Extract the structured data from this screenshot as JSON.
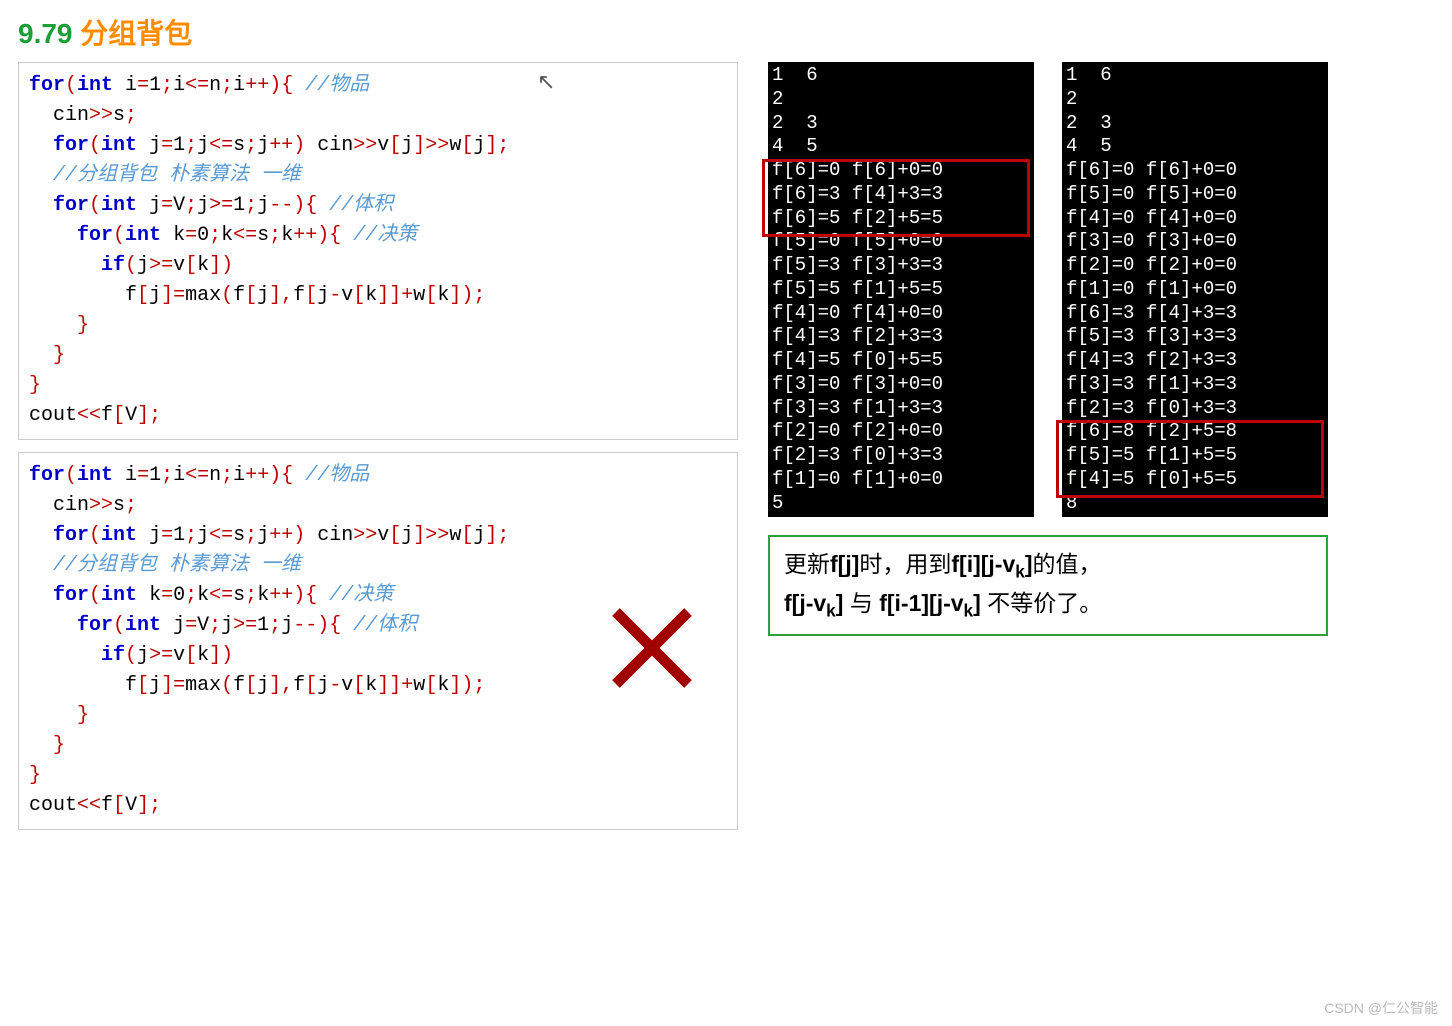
{
  "title": {
    "num": "9.79",
    "txt": "分组背包"
  },
  "code1": {
    "l1a": "for",
    "l1b": "(",
    "l1c": "int",
    "l1d": " i",
    "l1e": "=",
    "l1f": "1",
    "l1g": ";",
    "l1h": "i",
    "l1i": "<=",
    "l1j": "n",
    "l1k": ";",
    "l1l": "i",
    "l1m": "++){",
    "l1n": " //物品",
    "l2a": "  cin",
    "l2b": ">>",
    "l2c": "s",
    "l2d": ";",
    "l3a": "  ",
    "l3b": "for",
    "l3c": "(",
    "l3d": "int",
    "l3e": " j",
    "l3f": "=",
    "l3g": "1",
    "l3h": ";",
    "l3i": "j",
    "l3j": "<=",
    "l3k": "s",
    "l3l": ";",
    "l3m": "j",
    "l3n": "++)",
    "l3o": " cin",
    "l3p": ">>",
    "l3q": "v",
    "l3r": "[",
    "l3s": "j",
    "l3t": "]>>",
    "l3u": "w",
    "l3v": "[",
    "l3w": "j",
    "l3x": "];",
    "l4": "  //分组背包 朴素算法 一维",
    "l5a": "  ",
    "l5b": "for",
    "l5c": "(",
    "l5d": "int",
    "l5e": " j",
    "l5f": "=",
    "l5g": "V",
    "l5h": ";",
    "l5i": "j",
    "l5j": ">=",
    "l5k": "1",
    "l5l": ";",
    "l5m": "j",
    "l5n": "--){",
    "l5o": " //体积",
    "l6a": "    ",
    "l6b": "for",
    "l6c": "(",
    "l6d": "int",
    "l6e": " k",
    "l6f": "=",
    "l6g": "0",
    "l6h": ";",
    "l6i": "k",
    "l6j": "<=",
    "l6k": "s",
    "l6l": ";",
    "l6m": "k",
    "l6n": "++){",
    "l6o": " //决策",
    "l7a": "      ",
    "l7b": "if",
    "l7c": "(",
    "l7d": "j",
    "l7e": ">=",
    "l7f": "v",
    "l7g": "[",
    "l7h": "k",
    "l7i": "])",
    "l8a": "        f",
    "l8b": "[",
    "l8c": "j",
    "l8d": "]=",
    "l8e": "max",
    "l8f": "(",
    "l8g": "f",
    "l8h": "[",
    "l8i": "j",
    "l8j": "],",
    "l8k": "f",
    "l8l": "[",
    "l8m": "j",
    "l8n": "-",
    "l8o": "v",
    "l8p": "[",
    "l8q": "k",
    "l8r": "]]+",
    "l8s": "w",
    "l8t": "[",
    "l8u": "k",
    "l8v": "]);",
    "l9": "    }",
    "l10": "  }",
    "l11": "}",
    "l12a": "cout",
    "l12b": "<<",
    "l12c": "f",
    "l12d": "[",
    "l12e": "V",
    "l12f": "];"
  },
  "code2": {
    "l1a": "for",
    "l1b": "(",
    "l1c": "int",
    "l1d": " i",
    "l1e": "=",
    "l1f": "1",
    "l1g": ";",
    "l1h": "i",
    "l1i": "<=",
    "l1j": "n",
    "l1k": ";",
    "l1l": "i",
    "l1m": "++){",
    "l1n": " //物品",
    "l2a": "  cin",
    "l2b": ">>",
    "l2c": "s",
    "l2d": ";",
    "l3a": "  ",
    "l3b": "for",
    "l3c": "(",
    "l3d": "int",
    "l3e": " j",
    "l3f": "=",
    "l3g": "1",
    "l3h": ";",
    "l3i": "j",
    "l3j": "<=",
    "l3k": "s",
    "l3l": ";",
    "l3m": "j",
    "l3n": "++)",
    "l3o": " cin",
    "l3p": ">>",
    "l3q": "v",
    "l3r": "[",
    "l3s": "j",
    "l3t": "]>>",
    "l3u": "w",
    "l3v": "[",
    "l3w": "j",
    "l3x": "];",
    "l4": "  //分组背包 朴素算法 一维",
    "l5a": "  ",
    "l5b": "for",
    "l5c": "(",
    "l5d": "int",
    "l5e": " k",
    "l5f": "=",
    "l5g": "0",
    "l5h": ";",
    "l5i": "k",
    "l5j": "<=",
    "l5k": "s",
    "l5l": ";",
    "l5m": "k",
    "l5n": "++){",
    "l5o": " //决策",
    "l6a": "    ",
    "l6b": "for",
    "l6c": "(",
    "l6d": "int",
    "l6e": " j",
    "l6f": "=",
    "l6g": "V",
    "l6h": ";",
    "l6i": "j",
    "l6j": ">=",
    "l6k": "1",
    "l6l": ";",
    "l6m": "j",
    "l6n": "--){",
    "l6o": " //体积",
    "l7a": "      ",
    "l7b": "if",
    "l7c": "(",
    "l7d": "j",
    "l7e": ">=",
    "l7f": "v",
    "l7g": "[",
    "l7h": "k",
    "l7i": "])",
    "l8a": "        f",
    "l8b": "[",
    "l8c": "j",
    "l8d": "]=",
    "l8e": "max",
    "l8f": "(",
    "l8g": "f",
    "l8h": "[",
    "l8i": "j",
    "l8j": "],",
    "l8k": "f",
    "l8l": "[",
    "l8m": "j",
    "l8n": "-",
    "l8o": "v",
    "l8p": "[",
    "l8q": "k",
    "l8r": "]]+",
    "l8s": "w",
    "l8t": "[",
    "l8u": "k",
    "l8v": "]);",
    "l9": "    }",
    "l10": "  }",
    "l11": "}",
    "l12a": "cout",
    "l12b": "<<",
    "l12c": "f",
    "l12d": "[",
    "l12e": "V",
    "l12f": "];"
  },
  "console1": [
    "1  6",
    "2",
    "2  3",
    "4  5",
    "f[6]=0 f[6]+0=0",
    "f[6]=3 f[4]+3=3",
    "f[6]=5 f[2]+5=5",
    "f[5]=0 f[5]+0=0",
    "f[5]=3 f[3]+3=3",
    "f[5]=5 f[1]+5=5",
    "f[4]=0 f[4]+0=0",
    "f[4]=3 f[2]+3=3",
    "f[4]=5 f[0]+5=5",
    "f[3]=0 f[3]+0=0",
    "f[3]=3 f[1]+3=3",
    "f[2]=0 f[2]+0=0",
    "f[2]=3 f[0]+3=3",
    "f[1]=0 f[1]+0=0",
    "5"
  ],
  "console2": [
    "1  6",
    "2",
    "2  3",
    "4  5",
    "f[6]=0 f[6]+0=0",
    "f[5]=0 f[5]+0=0",
    "f[4]=0 f[4]+0=0",
    "f[3]=0 f[3]+0=0",
    "f[2]=0 f[2]+0=0",
    "f[1]=0 f[1]+0=0",
    "f[6]=3 f[4]+3=3",
    "f[5]=3 f[3]+3=3",
    "f[4]=3 f[2]+3=3",
    "f[3]=3 f[1]+3=3",
    "f[2]=3 f[0]+3=3",
    "f[6]=8 f[2]+5=8",
    "f[5]=5 f[1]+5=5",
    "f[4]=5 f[0]+5=5",
    "8"
  ],
  "note": {
    "p1a": "更新",
    "p1b": "f[j]",
    "p1c": "时，用到",
    "p1d": "f[i][j-v",
    "p1e": "k",
    "p1f": "]",
    "p1g": "的值，",
    "p2a": "f[j-v",
    "p2b": "k",
    "p2c": "]",
    "p2d": " 与 ",
    "p2e": "f[i-1][j-v",
    "p2f": "k",
    "p2g": "]",
    "p2h": " 不等价了。"
  },
  "watermark": "CSDN @仁公智能"
}
